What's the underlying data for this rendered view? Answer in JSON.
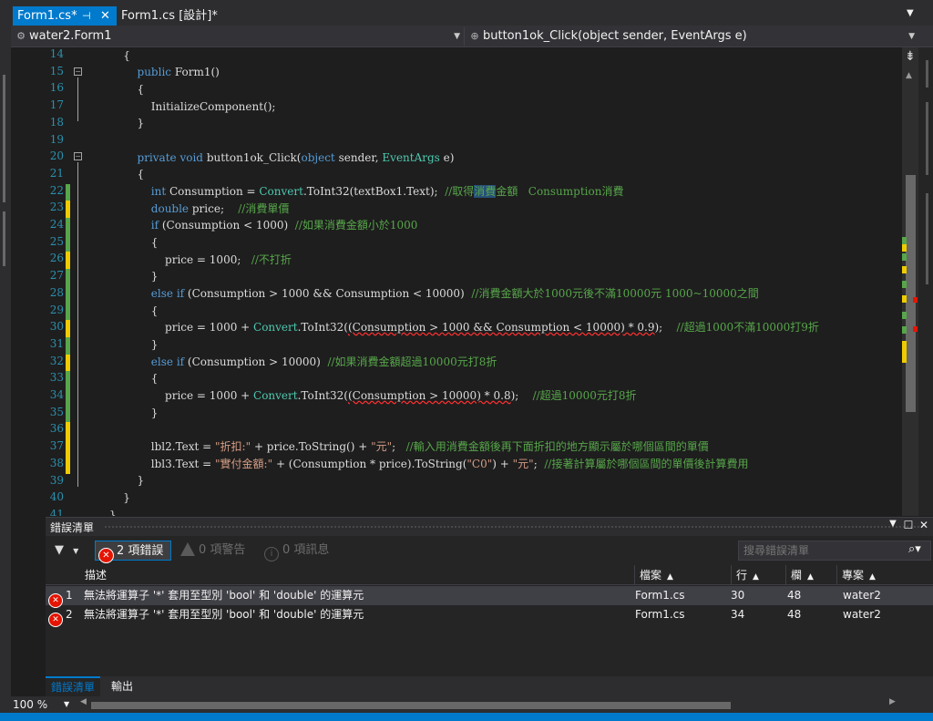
{
  "tabs": {
    "active_label": "Form1.cs*",
    "pin_glyph": "⌘",
    "close_glyph": "✕",
    "design_label": "Form1.cs [設計]*"
  },
  "nav": {
    "class_label": "water2.Form1",
    "method_label": "button1ok_Click(object sender, EventArgs e)"
  },
  "editor": {
    "line_numbers": [
      "14",
      "15",
      "16",
      "17",
      "18",
      "19",
      "20",
      "21",
      "22",
      "23",
      "24",
      "25",
      "26",
      "27",
      "28",
      "29",
      "30",
      "31",
      "32",
      "33",
      "34",
      "35",
      "36",
      "37",
      "38",
      "39",
      "40",
      "41"
    ]
  },
  "error_list": {
    "title": "錯誤清單",
    "errors_toggle": "2 項錯誤",
    "warnings_toggle": "0 項警告",
    "messages_toggle": "0 項訊息",
    "search_placeholder": "搜尋錯誤清單",
    "columns": {
      "description": "描述",
      "file": "檔案",
      "line": "行",
      "column": "欄",
      "project": "專案"
    },
    "rows": [
      {
        "index": "1",
        "description": "無法將運算子 '*' 套用至型別 'bool' 和 'double' 的運算元",
        "file": "Form1.cs",
        "line": "30",
        "column": "48",
        "project": "water2"
      },
      {
        "index": "2",
        "description": "無法將運算子 '*' 套用至型別 'bool' 和 'double' 的運算元",
        "file": "Form1.cs",
        "line": "34",
        "column": "48",
        "project": "water2"
      }
    ],
    "bottom_tabs": {
      "errors": "錯誤清單",
      "output": "輸出"
    }
  },
  "status": {
    "zoom": "100 %"
  },
  "colors": {
    "accent": "#007acc",
    "editor_bg": "#1e1e1e",
    "keyword": "#569cd6",
    "type": "#4ec9b0",
    "string": "#d69d85",
    "comment": "#57a64a",
    "line_number": "#2b91af",
    "change_saved": "#57a64a",
    "change_unsaved": "#efcc00",
    "error": "#e51400"
  },
  "icons": {
    "filter": "filter-icon",
    "error": "error-icon",
    "warning": "warning-icon",
    "info": "info-icon",
    "search": "search-icon"
  }
}
